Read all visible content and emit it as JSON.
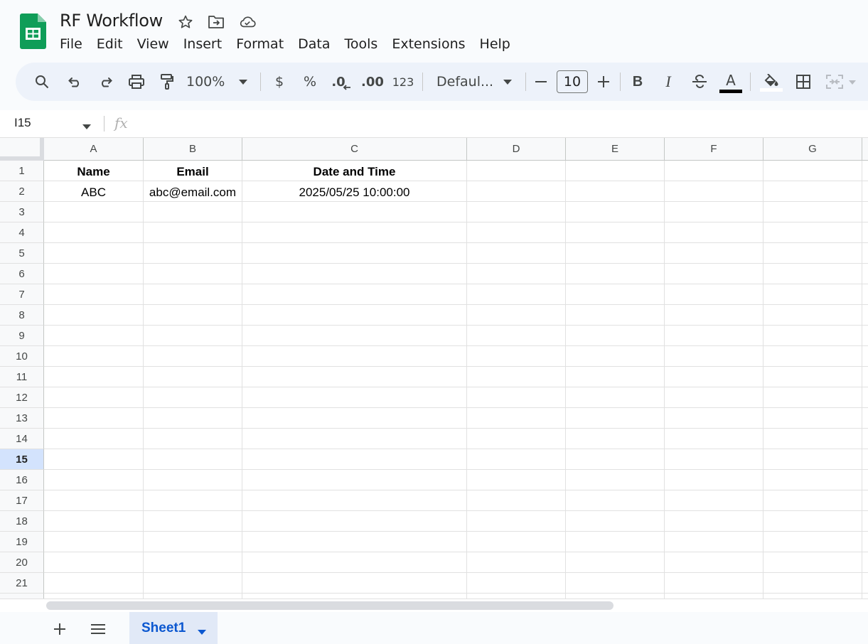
{
  "document": {
    "title": "RF Workflow"
  },
  "menu": [
    "File",
    "Edit",
    "View",
    "Insert",
    "Format",
    "Data",
    "Tools",
    "Extensions",
    "Help"
  ],
  "toolbar": {
    "zoom": "100%",
    "currency_label": "$",
    "percent_label": "%",
    "decimal_decrease_label": ".0",
    "decimal_increase_label": ".00",
    "number_format_label": "123",
    "font": "Defaul...",
    "font_size": "10",
    "bold_label": "B",
    "italic_label": "I",
    "text_color_label": "A"
  },
  "formula_bar": {
    "name_box": "I15",
    "fx_label": "fx",
    "formula": ""
  },
  "grid": {
    "columns": [
      "A",
      "B",
      "C",
      "D",
      "E",
      "F",
      "G"
    ],
    "rows": [
      "1",
      "2",
      "3",
      "4",
      "5",
      "6",
      "7",
      "8",
      "9",
      "10",
      "11",
      "12",
      "13",
      "14",
      "15",
      "16",
      "17",
      "18",
      "19",
      "20",
      "21"
    ],
    "active_row": "15",
    "cells": {
      "A1": "Name",
      "B1": "Email",
      "C1": "Date and Time",
      "A2": "ABC",
      "B2": "abc@email.com",
      "C2": "2025/05/25 10:00:00"
    }
  },
  "sheets": {
    "tabs": [
      {
        "label": "Sheet1",
        "active": true
      }
    ]
  },
  "colors": {
    "logo_green": "#0f9d58",
    "active_tab_text": "#0b57d0",
    "toolbar_bg": "#edf2fa"
  }
}
